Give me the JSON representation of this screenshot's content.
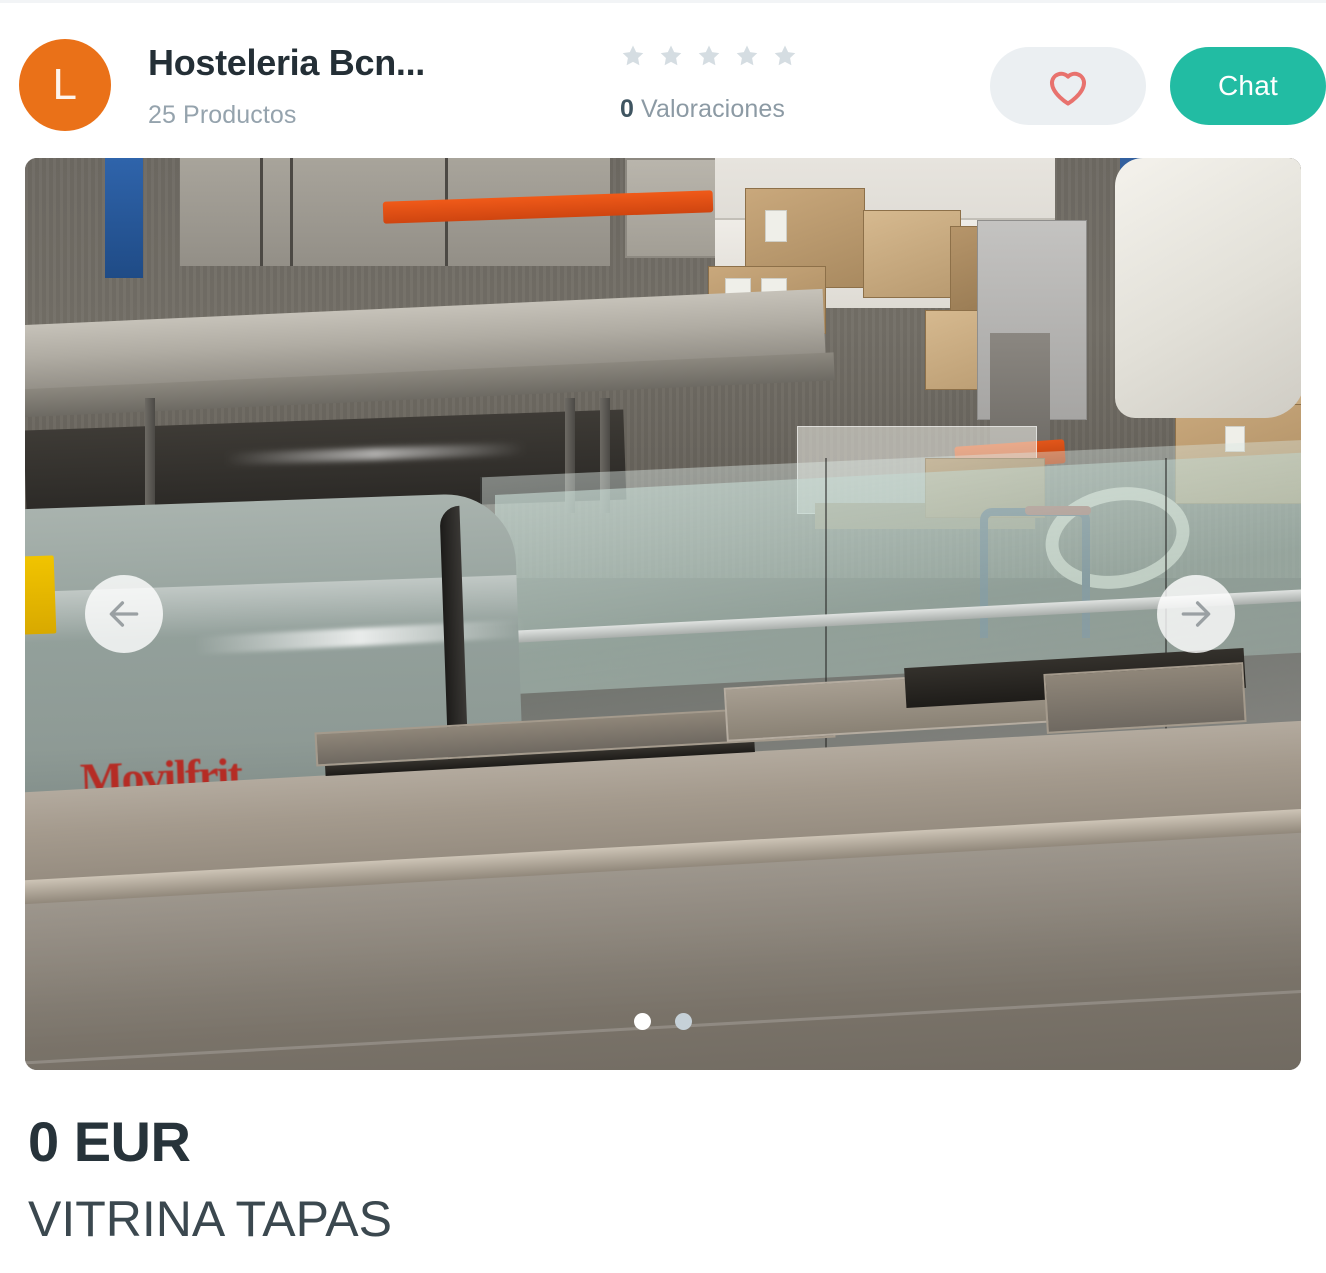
{
  "header": {
    "avatar_letter": "L",
    "avatar_color": "#ea7118",
    "shop_name": "Hosteleria Bcn...",
    "products_count": "25 Productos",
    "rating": {
      "stars_total": 5,
      "stars_filled": 0,
      "star_color": "#d5dde2",
      "count": "0",
      "label": " Valoraciones"
    },
    "favorite_button": {
      "icon": "heart-icon",
      "icon_color": "#e8726e",
      "background": "#ebeff2"
    },
    "chat_button": {
      "label": "Chat",
      "background": "#22bca3",
      "text_color": "#ffffff"
    }
  },
  "carousel": {
    "prev_icon": "arrow-left-icon",
    "next_icon": "arrow-right-icon",
    "slides_total": 2,
    "active_slide": 1,
    "image_alt": "VITRINA TAPAS refrigerated display case in warehouse",
    "brand_on_case": "Movilfrit",
    "dot_active_color": "#ffffff",
    "dot_inactive_color": "#c6d1d8"
  },
  "product": {
    "price": "0 EUR",
    "title": "VITRINA TAPAS"
  }
}
